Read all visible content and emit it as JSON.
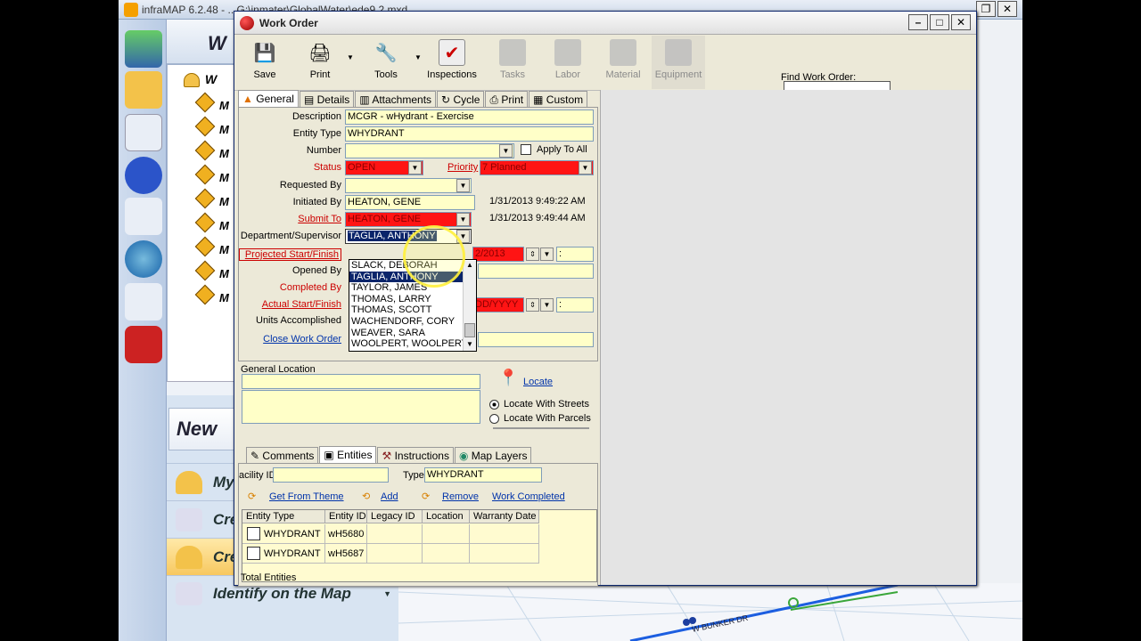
{
  "app": {
    "title": "infraMAP 6.2.48 - ...G:\\inmater\\GlobalWater\\ede9.2.mxd",
    "close_glyph": "✕",
    "restore_glyph": "❐"
  },
  "tree": {
    "root_label": "W",
    "items": [
      "M",
      "M",
      "M",
      "M",
      "M",
      "M",
      "M",
      "M",
      "M"
    ]
  },
  "left_panel": {
    "new_label": "New",
    "nav": [
      {
        "label": "My",
        "icon": "hardhat-icon"
      },
      {
        "label": "Cre",
        "icon": "pencil-icon"
      },
      {
        "label": "Cre",
        "icon": "hardhat-icon"
      },
      {
        "label": "Identify on the Map",
        "icon": "map-identify-icon"
      }
    ]
  },
  "map": {
    "street_label": "W BUNKER DR"
  },
  "work_order": {
    "title": "Work Order",
    "toolbar": [
      {
        "label": "Save",
        "icon": "save-icon",
        "enabled": true
      },
      {
        "label": "Print",
        "icon": "print-icon",
        "enabled": true
      },
      {
        "label": "Tools",
        "icon": "tools-icon",
        "enabled": true
      },
      {
        "label": "Inspections",
        "icon": "inspections-icon",
        "enabled": true
      },
      {
        "label": "Tasks",
        "icon": "tasks-icon",
        "enabled": false
      },
      {
        "label": "Labor",
        "icon": "labor-icon",
        "enabled": false
      },
      {
        "label": "Material",
        "icon": "material-icon",
        "enabled": false
      },
      {
        "label": "Equipment",
        "icon": "equipment-icon",
        "enabled": false
      }
    ],
    "find_label": "Find Work Order:",
    "find_value": "",
    "tabs": [
      "General",
      "Details",
      "Attachments",
      "Cycle",
      "Print",
      "Custom"
    ],
    "fields": {
      "description_label": "Description",
      "description": "MCGR - wHydrant - Exercise",
      "entity_type_label": "Entity Type",
      "entity_type": "WHYDRANT",
      "number_label": "Number",
      "number": "",
      "apply_to_all": "Apply To All",
      "status_label": "Status",
      "status": "OPEN",
      "priority_label": "Priority",
      "priority": "7 Planned",
      "requested_by_label": "Requested By",
      "requested_by": "",
      "initiated_by_label": "Initiated By",
      "initiated_by": "HEATON, GENE",
      "initiated_date": "1/31/2013 9:49:22 AM",
      "submit_to_label": "Submit To",
      "submit_to": "HEATON, GENE",
      "submit_date": "1/31/2013 9:49:44 AM",
      "dept_label": "Department/Supervisor",
      "dept": "TAGLIA, ANTHONY",
      "projected_label": "Projected Start/Finish",
      "projected_finish": "2/2013",
      "opened_by_label": "Opened By",
      "completed_by_label": "Completed By",
      "actual_label": "Actual Start/Finish",
      "actual_finish": "DD/YYYY",
      "units_label": "Units Accomplished",
      "close_label": "Close Work Order",
      "time_sep": ":"
    },
    "dropdown_options": [
      "SLACK, DEBORAH",
      "TAGLIA, ANTHONY",
      "TAYLOR, JAMES",
      "THOMAS, LARRY",
      "THOMAS, SCOTT",
      "WACHENDORF, CORY",
      "WEAVER, SARA",
      "WOOLPERT, WOOLPERT"
    ],
    "dropdown_selected_index": 1,
    "location": {
      "general_location_label": "General Location",
      "locate_label": "Locate",
      "streets_label": "Locate With Streets",
      "parcels_label": "Locate With Parcels"
    },
    "entities": {
      "tabs": [
        "Comments",
        "Entities",
        "Instructions",
        "Map Layers"
      ],
      "facility_id_label": "acility ID",
      "type_label": "Type",
      "type_value": "WHYDRANT",
      "links": [
        "Get From Theme",
        "Add",
        "Remove",
        "Work Completed"
      ],
      "columns": [
        "Entity Type",
        "Entity ID",
        "Legacy ID",
        "Location",
        "Warranty Date"
      ],
      "rows": [
        [
          "WHYDRANT",
          "wH5680",
          "",
          "",
          ""
        ],
        [
          "WHYDRANT",
          "wH5687",
          "",
          "",
          ""
        ]
      ],
      "total_label": "Total Entities"
    }
  }
}
